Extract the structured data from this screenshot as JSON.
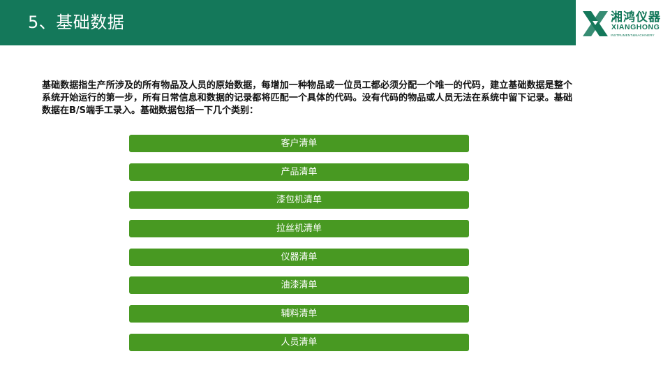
{
  "header": {
    "title": "5、基础数据",
    "background_color": "#14785a"
  },
  "logo": {
    "mark_icon": "x-shape-logo-icon",
    "cn_name": "湘鸿仪器",
    "en_name": "XIANGHONG",
    "tagline": "INSTRUMENT&MACHINERY",
    "color": "#14785a"
  },
  "intro": {
    "text": "基础数据指生产所涉及的所有物品及人员的原始数据，每增加一种物品或一位员工都必须分配一个唯一的代码，建立基础数据是整个系统开始运行的第一步，所有日常信息和数据的记录都将匹配一个具体的代码。没有代码的物品或人员无法在系统中留下记录。基础数据在B/S端手工录入。基础数据包括一下几个类别："
  },
  "categories": {
    "item_color": "#489922",
    "items": [
      {
        "label": "客户清单"
      },
      {
        "label": "产品清单"
      },
      {
        "label": "漆包机清单"
      },
      {
        "label": "拉丝机清单"
      },
      {
        "label": "仪器清单"
      },
      {
        "label": "油漆清单"
      },
      {
        "label": "辅料清单"
      },
      {
        "label": "人员清单"
      }
    ]
  }
}
